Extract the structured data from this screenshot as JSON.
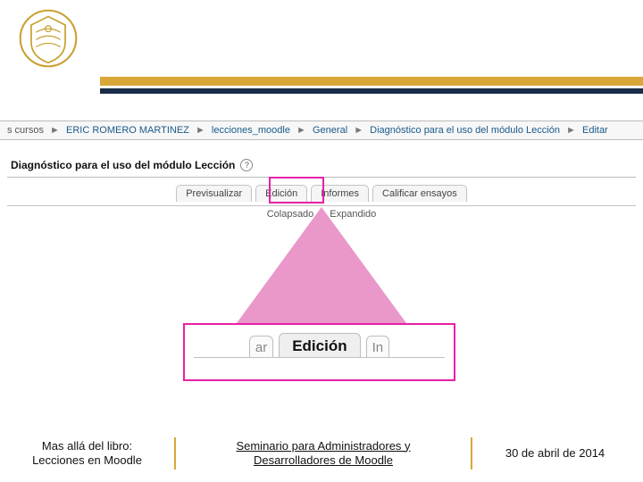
{
  "breadcrumb": {
    "items": [
      {
        "label": "cursos",
        "partial": "s cursos",
        "link": false
      },
      {
        "label": "ERIC ROMERO MARTINEZ",
        "link": true
      },
      {
        "label": "lecciones_moodle",
        "link": true
      },
      {
        "label": "General",
        "link": true
      },
      {
        "label": "Diagnóstico para el uso del módulo Lección",
        "link": true
      },
      {
        "label": "Editar",
        "link": true
      }
    ],
    "sep": "►"
  },
  "header": {
    "title": "Diagnóstico para el uso del módulo Lección",
    "help_glyph": "?"
  },
  "tabs": {
    "main": [
      {
        "label": "Previsualizar"
      },
      {
        "label": "Edición"
      },
      {
        "label": "Informes"
      },
      {
        "label": "Calificar ensayos"
      }
    ],
    "sub": [
      {
        "label": "Colapsado"
      },
      {
        "label": "Expandido"
      }
    ]
  },
  "zoom": {
    "left": "ar",
    "active": "Edición",
    "right": "In"
  },
  "footer": {
    "left_l1": "Mas allá del libro:",
    "left_l2": "Lecciones en Moodle",
    "mid_l1": "Seminario para Administradores y",
    "mid_l2": "Desarrolladores de Moodle",
    "right": "30 de abril de 2014"
  }
}
